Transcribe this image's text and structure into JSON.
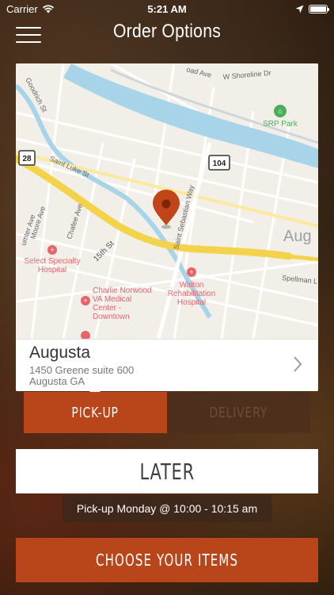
{
  "status_bar": {
    "carrier": "Carrier",
    "time": "5:21 AM",
    "battery_level": 1.0
  },
  "nav": {
    "title": "Order Options",
    "menu_icon": "hamburger-icon"
  },
  "map": {
    "labels": {
      "goodrich_st": "Goodrich St",
      "shoreline_dr": "W Shoreline Dr",
      "ad_ave": "oad Ave",
      "srp_park": "SRP Park",
      "route_28": "28",
      "route_104": "104",
      "saint_luke_st": "Saint Luke St",
      "saint_sebastian_way": "Saint Sebastian Way",
      "augusta_city": "Aug",
      "sumter_ave": "umter Ave",
      "moore_ave": "Moore Ave",
      "chafee_ave": "Chafee Ave",
      "fifteenth_st": "15th St",
      "select_specialty_1": "Select Specialty",
      "select_specialty_2": "Hospital",
      "charlie_norwood_1": "Charlie Norwood",
      "charlie_norwood_2": "VA Medical",
      "charlie_norwood_3": "Center -",
      "charlie_norwood_4": "Downtown",
      "walton_1": "Walton",
      "walton_2": "Rehabilitation",
      "walton_3": "Hospital",
      "spellman": "Spellman L"
    },
    "colors": {
      "water": "#a8d4ea",
      "highway": "#f3d34a",
      "pin": "#c2451a",
      "hospital": "#e8646b",
      "park": "#4cae5b"
    }
  },
  "location": {
    "name": "Augusta",
    "address_line1": "1450 Greene suite 600",
    "address_line2": "Augusta GA"
  },
  "order_mode": {
    "pickup_label": "PICK-UP",
    "delivery_label": "DELIVERY",
    "selected": "pickup"
  },
  "timing": {
    "later_label": "LATER",
    "time_text": "Pick-up Monday @ 10:00 - 10:15 am"
  },
  "actions": {
    "choose_items_label": "CHOOSE YOUR ITEMS"
  }
}
